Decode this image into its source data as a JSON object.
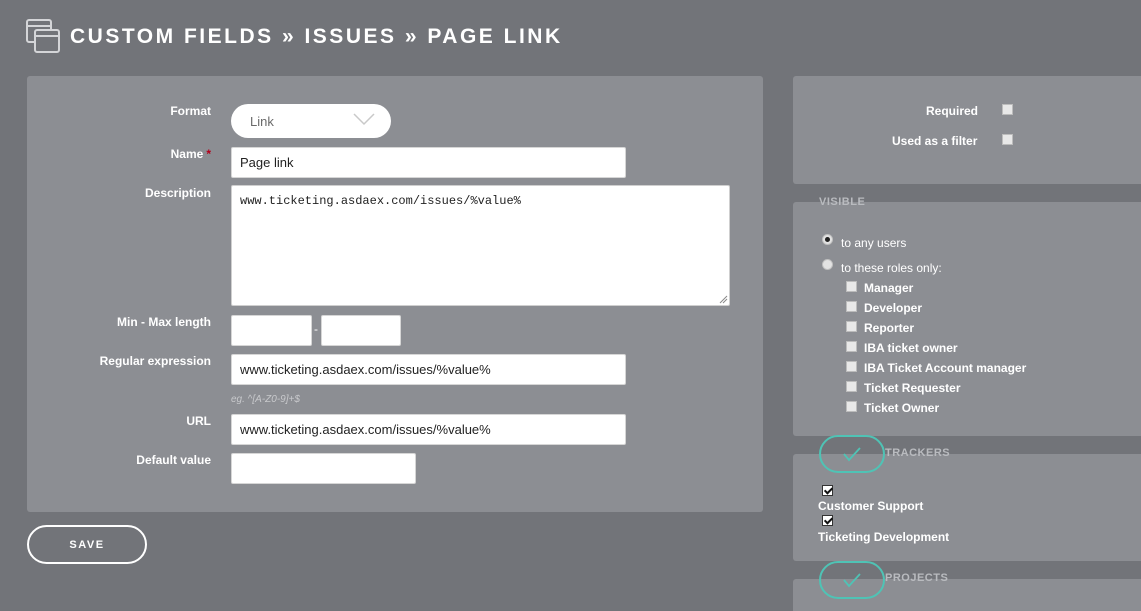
{
  "header": {
    "title": "CUSTOM FIELDS » ISSUES » PAGE LINK",
    "icon": "windows-icon"
  },
  "form": {
    "format_label": "Format",
    "format_value": "Link",
    "name_label": "Name",
    "name_required_mark": "*",
    "name_value": "Page link",
    "description_label": "Description",
    "description_value": "www.ticketing.asdaex.com/issues/%value%",
    "minmax_label": "Min - Max length",
    "min_value": "",
    "minmax_separator": "-",
    "max_value": "",
    "regex_label": "Regular expression",
    "regex_value": "www.ticketing.asdaex.com/issues/%value%",
    "regex_hint": "eg. ^[A-Z0-9]+$",
    "url_label": "URL",
    "url_value": "www.ticketing.asdaex.com/issues/%value%",
    "default_label": "Default value",
    "default_value": ""
  },
  "actions": {
    "save_label": "SAVE"
  },
  "options": {
    "required_label": "Required",
    "required_checked": false,
    "filter_label": "Used as a filter",
    "filter_checked": false
  },
  "visible": {
    "title": "VISIBLE",
    "any_users_label": "to any users",
    "roles_only_label": "to these roles only:",
    "selected": "to any users",
    "roles": [
      {
        "label": "Manager",
        "checked": false
      },
      {
        "label": "Developer",
        "checked": false
      },
      {
        "label": "Reporter",
        "checked": false
      },
      {
        "label": "IBA ticket owner",
        "checked": false
      },
      {
        "label": "IBA Ticket Account manager",
        "checked": false
      },
      {
        "label": "Ticket Requester",
        "checked": false
      },
      {
        "label": "Ticket Owner",
        "checked": false
      }
    ]
  },
  "trackers": {
    "title": "TRACKERS",
    "items": [
      {
        "label": "Customer Support",
        "checked": true
      },
      {
        "label": "Ticketing Development",
        "checked": true
      }
    ]
  },
  "projects": {
    "title": "PROJECTS"
  },
  "colors": {
    "background": "#727479",
    "panel": "#8c8e93",
    "accent": "#4fc3b5",
    "required_star": "#b3001b"
  }
}
